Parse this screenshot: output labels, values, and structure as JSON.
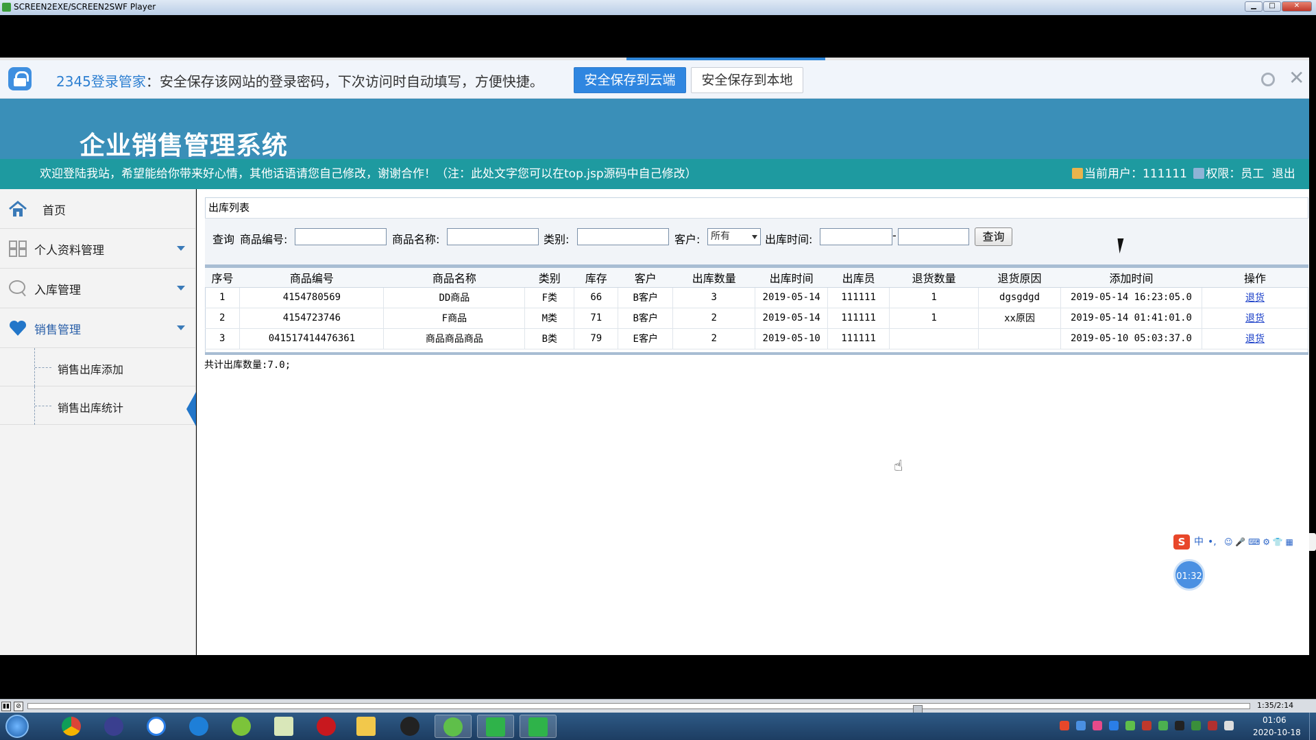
{
  "window": {
    "title": "SCREEN2EXE/SCREEN2SWF Player",
    "min": "▁",
    "max": "□",
    "close": "✕"
  },
  "pwbar": {
    "brand": "2345登录管家",
    "message": "：安全保存该网站的登录密码，下次访问时自动填写，方便快捷。",
    "save_cloud": "安全保存到云端",
    "save_local": "安全保存到本地",
    "close": "✕"
  },
  "app": {
    "title": "企业销售管理系统",
    "welcome": "欢迎登陆我站，希望能给你带来好心情，其他话语请您自己修改，谢谢合作！（注：此处文字您可以在top.jsp源码中自己修改）",
    "current_user": "当前用户：111111",
    "role": "权限：员工",
    "logout": "退出"
  },
  "sidebar": {
    "items": [
      {
        "label": "首页"
      },
      {
        "label": "个人资料管理"
      },
      {
        "label": "入库管理"
      },
      {
        "label": "销售管理"
      }
    ],
    "sub_items": [
      {
        "label": "销售出库添加"
      },
      {
        "label": "销售出库统计"
      }
    ]
  },
  "panel": {
    "title": "出库列表",
    "filters": {
      "query_label": "查询",
      "code_label": "商品编号:",
      "name_label": "商品名称:",
      "category_label": "类别:",
      "customer_label": "客户:",
      "customer_value": "所有",
      "time_label": "出库时间:",
      "time_dash": "-",
      "query_button": "查询"
    }
  },
  "table": {
    "headers": [
      "序号",
      "商品编号",
      "商品名称",
      "类别",
      "库存",
      "客户",
      "出库数量",
      "出库时间",
      "出库员",
      "退货数量",
      "退货原因",
      "添加时间",
      "操作"
    ],
    "rows": [
      [
        "1",
        "4154780569",
        "DD商品",
        "F类",
        "66",
        "B客户",
        "3",
        "2019-05-14",
        "111111",
        "1",
        "dgsgdgd",
        "2019-05-14 16:23:05.0",
        "退货"
      ],
      [
        "2",
        "4154723746",
        "F商品",
        "M类",
        "71",
        "B客户",
        "2",
        "2019-05-14",
        "111111",
        "1",
        "xx原因",
        "2019-05-14 01:41:01.0",
        "退货"
      ],
      [
        "3",
        "041517414476361",
        "商品商品商品",
        "B类",
        "79",
        "E客户",
        "2",
        "2019-05-10",
        "111111",
        "",
        "",
        "2019-05-10 05:03:37.0",
        "退货"
      ]
    ],
    "total": "共计出库数量:7.0;"
  },
  "ime": {
    "logo": "S",
    "mode": "中",
    "punct": "•,",
    "icons": "☺ 🎤 ⌨ ⚙ 👕 ▦"
  },
  "timer": "01:32",
  "player": {
    "play": "▮▮",
    "stop": "⊘",
    "time": "1:35/2:14",
    "progress": 0.73
  },
  "clock": {
    "time": "01:06",
    "date": "2020-10-18"
  },
  "colors": {
    "header": "#3a8fb8",
    "welcome_bar": "#1e9aa0",
    "accent": "#2f86e0"
  }
}
